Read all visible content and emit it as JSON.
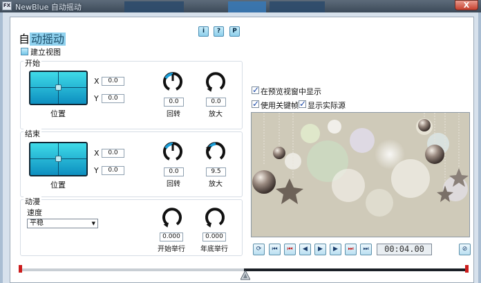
{
  "window": {
    "title": "NewBlue 自动摇动",
    "close_label": "X"
  },
  "dialog": {
    "heading_prefix": "自",
    "heading_highlight": "动摇动",
    "info_btn": "i",
    "help_btn": "?",
    "preset_btn": "P",
    "build_view_label": "建立视图"
  },
  "start_group": {
    "title": "开始",
    "position_label": "位置",
    "x_label": "X",
    "x_value": "0.0",
    "y_label": "Y",
    "y_value": "0.0",
    "rotate_value": "0.0",
    "rotate_label": "回转",
    "zoom_value": "0.0",
    "zoom_label": "放大"
  },
  "end_group": {
    "title": "结束",
    "position_label": "位置",
    "x_label": "X",
    "x_value": "0.0",
    "y_label": "Y",
    "y_value": "0.0",
    "rotate_value": "0.0",
    "rotate_label": "回转",
    "zoom_value": "9.5",
    "zoom_label": "放大"
  },
  "motion_group": {
    "title": "动漫",
    "speed_label": "速度",
    "speed_value": "平稳",
    "start_hold_value": "0.000",
    "start_hold_label": "开始举行",
    "end_hold_value": "0.000",
    "end_hold_label": "年底举行"
  },
  "options": {
    "show_in_preview": "在预览视窗中显示",
    "use_keyframes": "使用关键帧",
    "show_actual_source": "显示实际源"
  },
  "transport": {
    "timecode": "00:04.00"
  },
  "colors": {
    "accent": "#1a9fd9",
    "keyframe_red": "#cc1c1c",
    "pad_top": "#3fdbe8",
    "pad_bottom": "#0d8fc0"
  }
}
